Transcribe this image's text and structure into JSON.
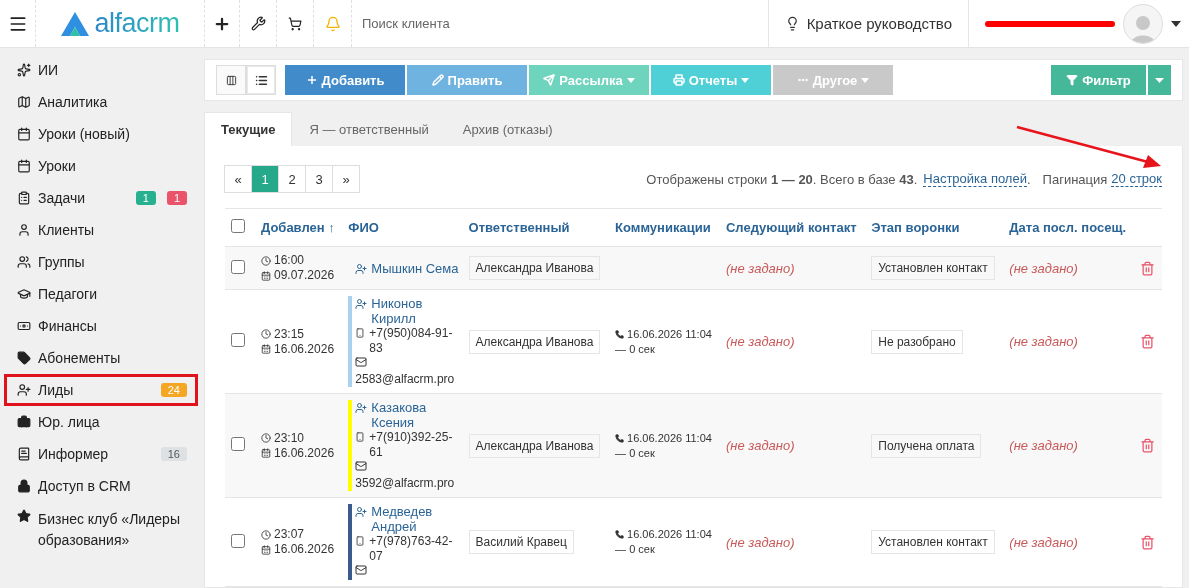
{
  "header": {
    "logo": "alfacrm",
    "search": {
      "placeholder": "Поиск клиента"
    },
    "guide": "Краткое руководство",
    "user_redacted": true
  },
  "sidebar": {
    "items": [
      {
        "label": "ИИ",
        "highlighted": false
      },
      {
        "label": "Аналитика",
        "highlighted": false
      },
      {
        "label": "Уроки (новый)",
        "highlighted": false
      },
      {
        "label": "Уроки",
        "highlighted": false
      },
      {
        "label": "Задачи",
        "highlighted": false,
        "badges": [
          {
            "text": "1",
            "color": "#26b08f"
          },
          {
            "text": "1",
            "color": "#e9546b"
          }
        ]
      },
      {
        "label": "Клиенты",
        "highlighted": false
      },
      {
        "label": "Группы",
        "highlighted": false
      },
      {
        "label": "Педагоги",
        "highlighted": false
      },
      {
        "label": "Финансы",
        "highlighted": false
      },
      {
        "label": "Абонементы",
        "highlighted": false
      },
      {
        "label": "Лиды",
        "highlighted": true,
        "badges": [
          {
            "text": "24",
            "color": "#f5a623"
          }
        ]
      },
      {
        "label": "Юр. лица",
        "highlighted": false
      },
      {
        "label": "Информер",
        "highlighted": false,
        "badges": [
          {
            "text": "16",
            "color": "#dde1e4"
          }
        ]
      },
      {
        "label": "Доступ в CRM",
        "highlighted": false
      },
      {
        "label": "Бизнес клуб «Лидеры образования»",
        "highlighted": false
      }
    ]
  },
  "toolbar": {
    "views": [
      {
        "selected": false
      },
      {
        "selected": true
      }
    ],
    "buttons": [
      {
        "label": "Добавить",
        "color": "#428bca",
        "dropdown": false
      },
      {
        "label": "Править",
        "color": "#6fb3e0",
        "dropdown": false
      },
      {
        "label": "Рассылка",
        "color": "#6fd4bd",
        "dropdown": true
      },
      {
        "label": "Отчеты",
        "color": "#4fcfd6",
        "dropdown": true
      },
      {
        "label": "Другое",
        "color": "#c9c9c9",
        "dropdown": true
      }
    ],
    "filter": {
      "label": "Фильтр",
      "color": "#45b89a"
    }
  },
  "tabs": [
    {
      "label": "Текущие",
      "selected": true
    },
    {
      "label": "Я — ответственный",
      "selected": false
    },
    {
      "label": "Архив (отказы)",
      "selected": false
    }
  ],
  "pagination": {
    "pages": [
      {
        "label": "«",
        "selected": false
      },
      {
        "label": "1",
        "selected": true
      },
      {
        "label": "2",
        "selected": false
      },
      {
        "label": "3",
        "selected": false
      },
      {
        "label": "»",
        "selected": false
      }
    ],
    "info": "Отображены строки **1 — 20**. Всего в базе **43**.",
    "fields_link": "Настройка полей",
    "fields_suffix": ".",
    "pagination_label": "Пагинация",
    "rows_link": "20 строк"
  },
  "table": {
    "all_checked": false,
    "columns": [
      "Добавлен ↑",
      "ФИО",
      "Ответственный",
      "Коммуникации",
      "Следующий контакт",
      "Этап воронки",
      "Дата посл. посещ."
    ],
    "rows": [
      {
        "checked": false,
        "time": "16:00",
        "date": "09.07.2026",
        "name": [
          "Мышкин Сема"
        ],
        "responsible": "Александра Иванова",
        "next": "(не задано)",
        "stage": "Установлен контакт",
        "last_visit": "(не задано)"
      },
      {
        "checked": false,
        "time": "23:15",
        "date": "16.06.2026",
        "color": "#a9d2ef",
        "name": [
          "Никонов",
          "Кирилл"
        ],
        "phone": [
          "+7(950)084-91-",
          "83"
        ],
        "email": [
          "2583@alfacrm.pro"
        ],
        "responsible": "Александра Иванова",
        "comm": [
          "16.06.2026 11:04",
          "— 0 сек"
        ],
        "next": "(не задано)",
        "stage": "Не разобрано",
        "last_visit": "(не задано)"
      },
      {
        "checked": false,
        "time": "23:10",
        "date": "16.06.2026",
        "color": "#ffff00",
        "name": [
          "Казакова",
          "Ксения"
        ],
        "phone": [
          "+7(910)392-25-",
          "61"
        ],
        "email": [
          "3592@alfacrm.pro"
        ],
        "responsible": "Александра Иванова",
        "comm": [
          "16.06.2026 11:04",
          "— 0 сек"
        ],
        "next": "(не задано)",
        "stage": "Получена оплата",
        "last_visit": "(не задано)"
      },
      {
        "checked": false,
        "time": "23:07",
        "date": "16.06.2026",
        "color": "#3b5b8c",
        "name": [
          "Медведев",
          "Андрей"
        ],
        "phone": [
          "+7(978)763-42-",
          "07"
        ],
        "responsible": "Василий Кравец",
        "comm": [
          "16.06.2026 11:04",
          "— 0 сек"
        ],
        "next": "(не задано)",
        "stage": "Установлен контакт",
        "last_visit": "(не задано)"
      }
    ]
  },
  "annotation": {
    "arrow": true
  }
}
